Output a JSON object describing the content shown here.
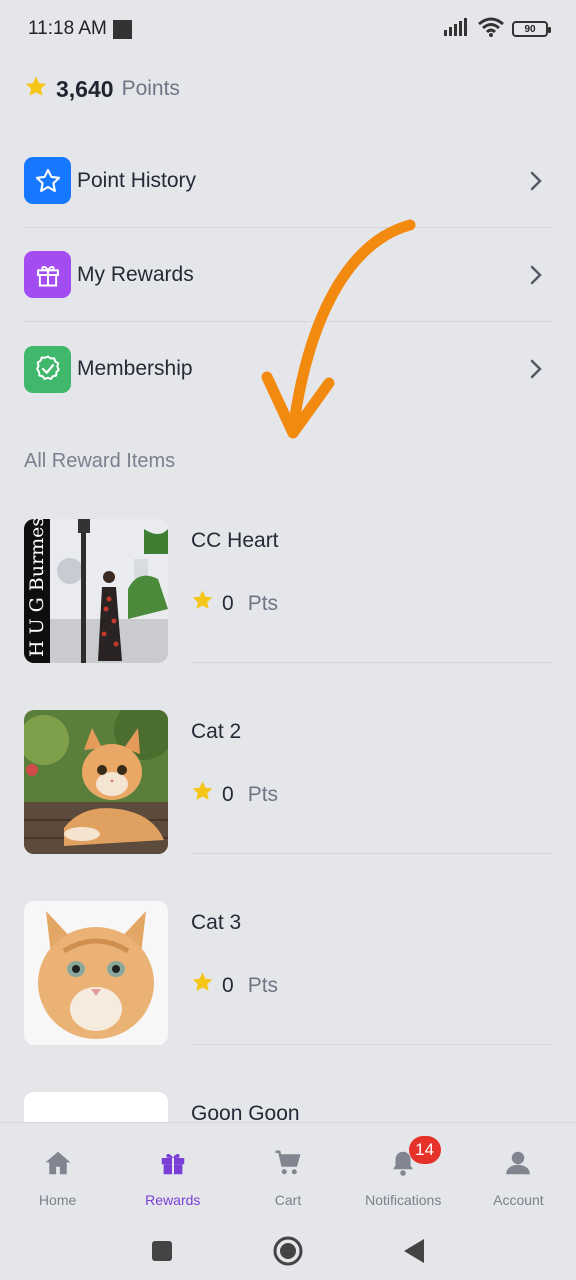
{
  "status_bar": {
    "time": "11:18 AM",
    "battery": "90"
  },
  "points": {
    "value": "3,640",
    "label": "Points",
    "icon": "star-icon"
  },
  "menu": [
    {
      "label": "Point History",
      "icon": "star-outline-icon",
      "color": "#1677ff"
    },
    {
      "label": "My Rewards",
      "icon": "gift-icon",
      "color": "#a24cf2"
    },
    {
      "label": "Membership",
      "icon": "badge-check-icon",
      "color": "#3fb86b"
    }
  ],
  "section_title": "All Reward Items",
  "reward_items": [
    {
      "name": "CC Heart",
      "points": "0",
      "unit": "Pts",
      "image": "fashion-photo",
      "image_text": "H U G Burmes"
    },
    {
      "name": "Cat 2",
      "points": "0",
      "unit": "Pts",
      "image": "kitten-photo"
    },
    {
      "name": "Cat 3",
      "points": "0",
      "unit": "Pts",
      "image": "kitten-portrait-photo"
    },
    {
      "name": "Goon Goon",
      "image": "white-logo-image"
    }
  ],
  "bottom_nav": [
    {
      "label": "Home",
      "icon": "home-icon",
      "active": false
    },
    {
      "label": "Rewards",
      "icon": "gift-icon",
      "active": true
    },
    {
      "label": "Cart",
      "icon": "cart-icon",
      "active": false
    },
    {
      "label": "Notifications",
      "icon": "bell-icon",
      "active": false,
      "badge": "14"
    },
    {
      "label": "Account",
      "icon": "user-icon",
      "active": false
    }
  ],
  "colors": {
    "accent": "#7b3fd8",
    "star": "#f5c518",
    "annotation_arrow": "#f38a10",
    "badge": "#e5332a"
  }
}
